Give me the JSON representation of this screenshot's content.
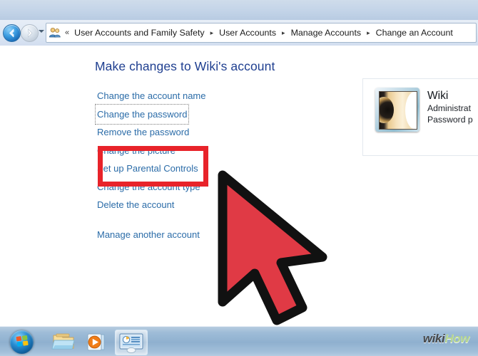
{
  "window": {
    "navigation": {
      "back_button": "Back",
      "forward_button": "Forward",
      "recent_pages_label": "Recent pages",
      "address_icon": "user-accounts-icon",
      "overflow_chevron": "«",
      "separator": "▸",
      "breadcrumbs": [
        "User Accounts and Family Safety",
        "User Accounts",
        "Manage Accounts",
        "Change an Account"
      ]
    }
  },
  "main": {
    "page_title": "Make changes to Wiki's account",
    "links": [
      {
        "label": "Change the account name",
        "focused": false,
        "highlighted": false,
        "spaced": false
      },
      {
        "label": "Change the password",
        "focused": true,
        "highlighted": true,
        "spaced": false
      },
      {
        "label": "Remove the password",
        "focused": false,
        "highlighted": true,
        "spaced": false
      },
      {
        "label": "Change the picture",
        "focused": false,
        "highlighted": false,
        "spaced": false
      },
      {
        "label": "Set up Parental Controls",
        "focused": false,
        "highlighted": false,
        "spaced": false
      },
      {
        "label": "Change the account type",
        "focused": false,
        "highlighted": false,
        "spaced": false
      },
      {
        "label": "Delete the account",
        "focused": false,
        "highlighted": false,
        "spaced": false
      },
      {
        "label": "Manage another account",
        "focused": false,
        "highlighted": false,
        "spaced": true
      }
    ],
    "account_panel": {
      "picture_icon": "guitar-account-picture",
      "name": "Wiki",
      "account_type": "Administrat",
      "password_status": "Password p"
    }
  },
  "annotations": {
    "highlight_box_color": "#e8232a",
    "cursor_fill_color": "#e03a45",
    "cursor_outline_color": "#111111",
    "cursor_name": "pointer-cursor"
  },
  "taskbar": {
    "start_button": "Start",
    "items": [
      {
        "name": "windows-explorer-taskbar-icon",
        "label": "Windows Explorer",
        "active": false
      },
      {
        "name": "windows-media-player-taskbar-icon",
        "label": "Windows Media Player",
        "active": false
      },
      {
        "name": "control-panel-taskbar-icon",
        "label": "Control Panel",
        "active": true
      }
    ]
  },
  "watermark": {
    "part_one": "wiki",
    "part_two": "How"
  },
  "colors": {
    "title_blue": "#1f3f90",
    "link_blue": "#2b6ca8",
    "annotation_red": "#e8232a",
    "taskbar_blue": "#8fb0cf"
  }
}
